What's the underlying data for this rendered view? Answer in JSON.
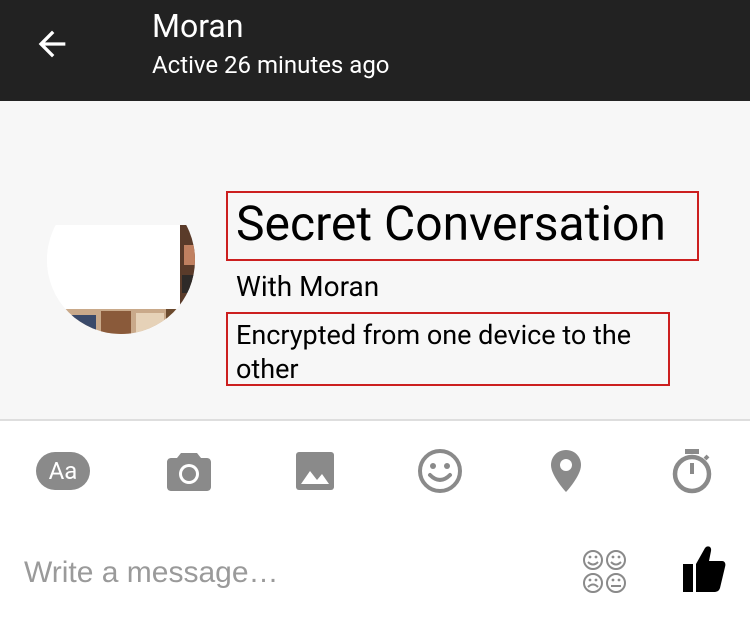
{
  "header": {
    "title": "Moran",
    "subtitle": "Active 26 minutes ago",
    "back_icon": "arrow-left-icon"
  },
  "conversation": {
    "title": "Secret Conversation",
    "with_text": "With Moran",
    "encryption_note": "Encrypted from one device to the other",
    "highlight_color": "#cc1f1f"
  },
  "toolbar": {
    "text_style_label": "Aa",
    "icons": [
      "text-style-icon",
      "camera-icon",
      "image-icon",
      "emoji-icon",
      "location-icon",
      "timer-icon"
    ]
  },
  "composer": {
    "placeholder": "Write a message…",
    "emoji_grid_icon": "emoji-grid-icon",
    "like_icon": "thumbs-up-icon"
  },
  "colors": {
    "header_bg": "#222222",
    "content_bg": "#f7f7f7",
    "icon_gray": "#8a8a8a"
  }
}
